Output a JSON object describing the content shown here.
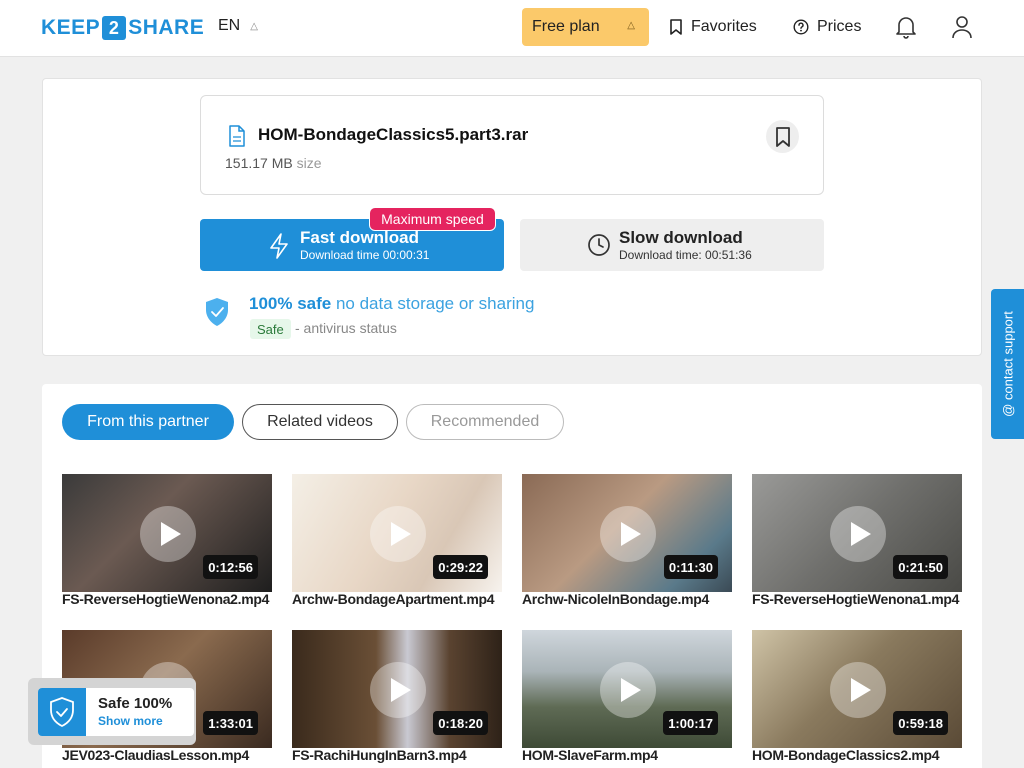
{
  "header": {
    "logo_left": "KEEP",
    "logo_mid": "2",
    "logo_right": "SHARE",
    "language": "EN",
    "plan_label": "Free plan",
    "favorites_label": "Favorites",
    "prices_label": "Prices"
  },
  "file": {
    "name": "HOM-BondageClassics5.part3.rar",
    "size_value": "151.17 MB",
    "size_unit": "size"
  },
  "download": {
    "fast_title": "Fast download",
    "fast_time": "Download time 00:00:31",
    "fast_badge": "Maximum speed",
    "slow_title": "Slow download",
    "slow_time": "Download time: 00:51:36"
  },
  "safety": {
    "strong": "100% safe",
    "weak": "no data storage or sharing",
    "badge": "Safe",
    "status": "- antivirus status"
  },
  "tabs": [
    "From this partner",
    "Related videos",
    "Recommended"
  ],
  "videos": [
    {
      "title": "FS-ReverseHogtieWenona2.mp4",
      "duration": "0:12:56"
    },
    {
      "title": "Archw-BondageApartment.mp4",
      "duration": "0:29:22"
    },
    {
      "title": "Archw-NicoleInBondage.mp4",
      "duration": "0:11:30"
    },
    {
      "title": "FS-ReverseHogtieWenona1.mp4",
      "duration": "0:21:50"
    },
    {
      "title": "JEV023-ClaudiasLesson.mp4",
      "duration": "1:33:01"
    },
    {
      "title": "FS-RachiHungInBarn3.mp4",
      "duration": "0:18:20"
    },
    {
      "title": "HOM-SlaveFarm.mp4",
      "duration": "1:00:17"
    },
    {
      "title": "HOM-BondageClassics2.mp4",
      "duration": "0:59:18"
    }
  ],
  "support_label": "@ contact support",
  "safe_widget": {
    "title": "Safe 100%",
    "link": "Show more"
  },
  "colors": {
    "accent": "#1f8fd8",
    "plan": "#fbc96a",
    "badge": "#e5245f"
  }
}
